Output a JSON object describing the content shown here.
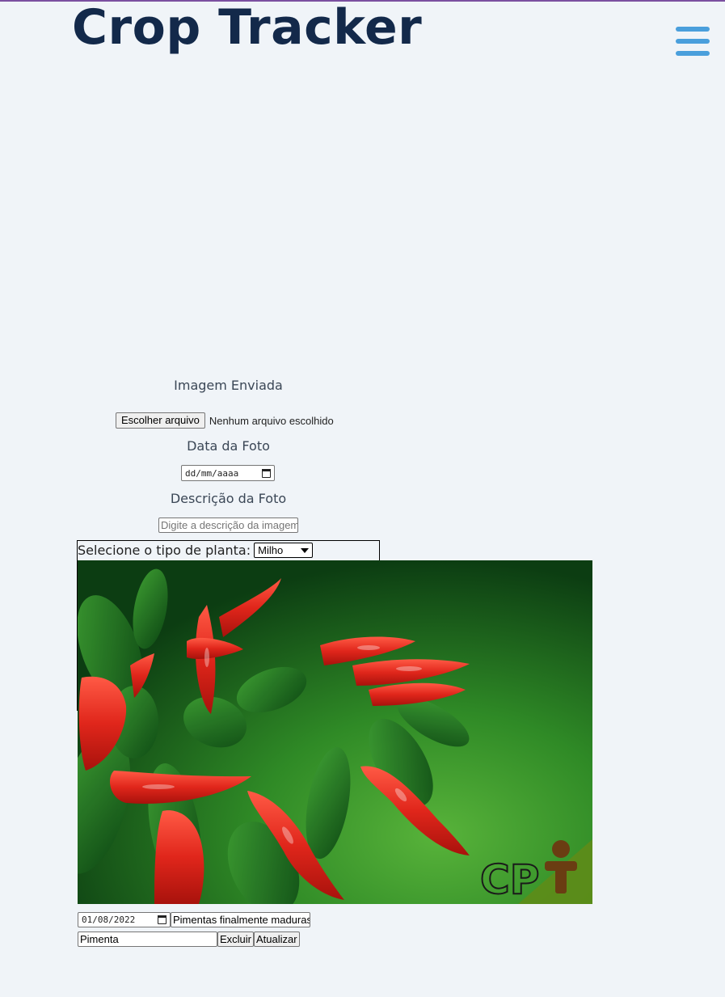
{
  "header": {
    "title": "Crop Tracker",
    "menu_icon": "hamburger-menu-icon"
  },
  "form": {
    "image_label": "Imagem Enviada",
    "file_button": "Escolher arquivo",
    "file_status": "Nenhum arquivo escolhido",
    "date_label": "Data da Foto",
    "date_placeholder": "dd/mm/aaaa",
    "description_label": "Descrição da Foto",
    "description_placeholder": "Digite a descrição da imagem",
    "plant_type_label": "Selecione o tipo de planta:",
    "plant_type_selected": "Milho"
  },
  "entry": {
    "photo_subject": "red chili peppers on plant",
    "photo_watermark": "CPT",
    "date": "01/08/2022",
    "description": "Pimentas finalmente maduras",
    "plant_type": "Pimenta",
    "delete_button": "Excluir",
    "update_button": "Atualizar"
  },
  "colors": {
    "background": "#f0f4f8",
    "title": "#13294a",
    "menu_accent": "#4a9fdc",
    "top_border": "#7b4fa0"
  }
}
